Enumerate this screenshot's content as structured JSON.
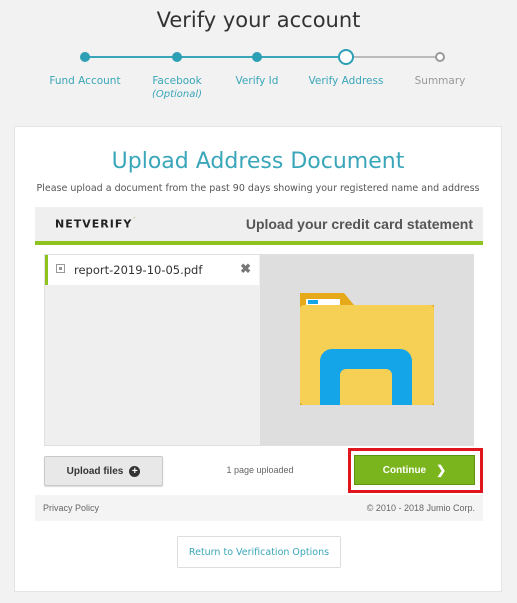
{
  "page": {
    "title": "Verify your account"
  },
  "stepper": {
    "steps": [
      {
        "label": "Fund Account",
        "sub": "",
        "state": "done"
      },
      {
        "label": "Facebook",
        "sub": "(Optional)",
        "state": "done"
      },
      {
        "label": "Verify Id",
        "sub": "",
        "state": "done"
      },
      {
        "label": "Verify Address",
        "sub": "",
        "state": "current"
      },
      {
        "label": "Summary",
        "sub": "",
        "state": "future"
      }
    ]
  },
  "card": {
    "title": "Upload Address Document",
    "subtitle": "Please upload a document from the past 90 days showing your registered name and address"
  },
  "netverify": {
    "logo": "NETVERIFY",
    "logo_mark": "´",
    "upload_title": "Upload your credit card statement",
    "accent": "#8dc21f"
  },
  "files": {
    "items": [
      {
        "name": "report-2019-10-05.pdf",
        "remove": "✖"
      }
    ],
    "upload_label": "Upload files",
    "upload_icon": "+",
    "pages_uploaded": "1 page uploaded",
    "continue_label": "Continue",
    "continue_icon": "❯"
  },
  "footer": {
    "privacy": "Privacy Policy",
    "copyright": "© 2010 - 2018 Jumio Corp."
  },
  "return_label": "Return to Verification Options",
  "colors": {
    "teal": "#3aa6b9",
    "green": "#7ab51d",
    "highlight": "#e0161e",
    "folder": "#f6cf55",
    "folder_front": "#13a5e8"
  }
}
